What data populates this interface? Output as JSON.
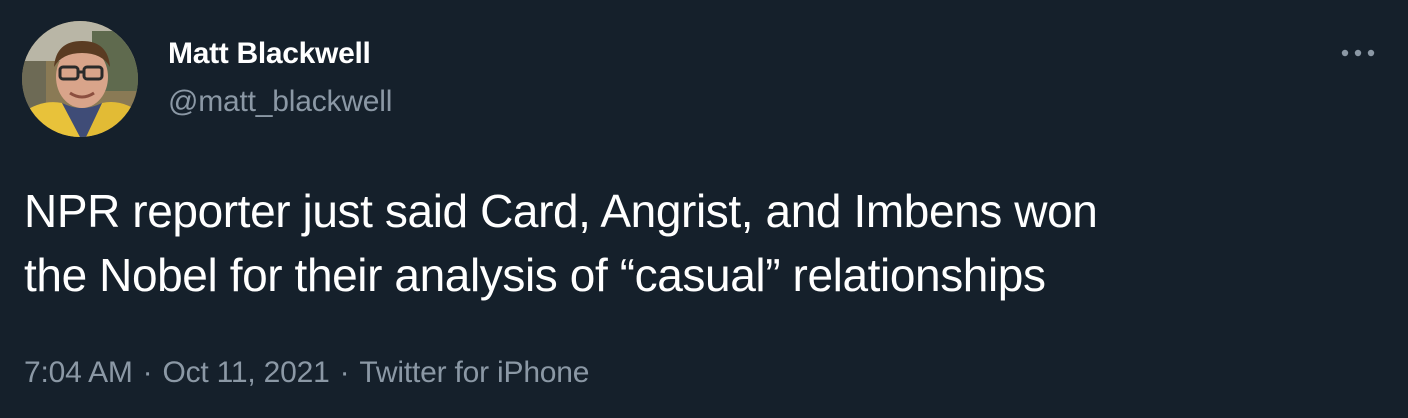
{
  "author": {
    "name": "Matt Blackwell",
    "handle": "@matt_blackwell"
  },
  "tweet": {
    "text_line1": "NPR reporter just said Card, Angrist, and Imbens won",
    "text_line2": "the Nobel for their analysis of “casual” relationships"
  },
  "meta": {
    "time": "7:04 AM",
    "date": "Oct 11, 2021",
    "source": "Twitter for iPhone",
    "separator": "·"
  },
  "icons": {
    "more": "more-horizontal-icon",
    "avatar": "profile-photo"
  },
  "colors": {
    "background": "#15202b",
    "primary_text": "#ffffff",
    "secondary_text": "#8b98a5"
  }
}
